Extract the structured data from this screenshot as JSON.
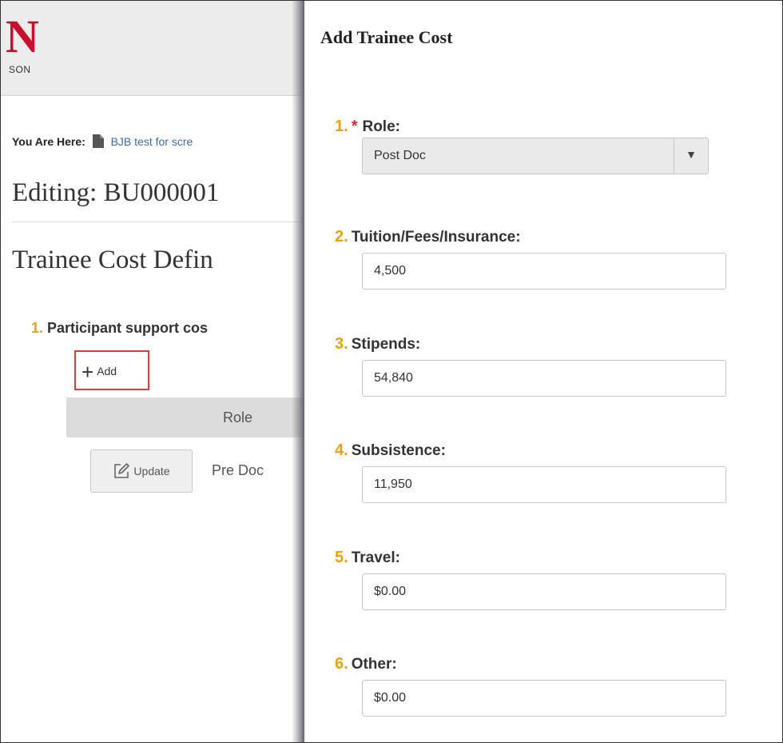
{
  "header": {
    "logo_letter": "N",
    "logo_sub": "SON"
  },
  "breadcrumb": {
    "label": "You Are Here:",
    "link": "BJB test for scre"
  },
  "page": {
    "title": "Editing: BU000001",
    "section_title": "Trainee Cost Defin"
  },
  "participant": {
    "number": "1.",
    "label": "Participant support cos",
    "add_label": "Add",
    "grid_header_role": "Role",
    "rows": [
      {
        "update_label": "Update",
        "role": "Pre Doc"
      }
    ]
  },
  "panel": {
    "title": "Add Trainee Cost",
    "fields": [
      {
        "number": "1.",
        "required": "*",
        "label": "Role:",
        "value": "Post Doc"
      },
      {
        "number": "2.",
        "label": "Tuition/Fees/Insurance:",
        "value": "4,500"
      },
      {
        "number": "3.",
        "label": "Stipends:",
        "value": "54,840"
      },
      {
        "number": "4.",
        "label": "Subsistence:",
        "value": "11,950"
      },
      {
        "number": "5.",
        "label": "Travel:",
        "value": "$0.00"
      },
      {
        "number": "6.",
        "label": "Other:",
        "value": "$0.00"
      }
    ]
  },
  "colors": {
    "accent_number": "#e8a317",
    "required": "#d32f2f",
    "link": "#3a6ea5",
    "logo": "#c8102e",
    "highlight_border": "#e53935"
  },
  "icons": {
    "document": "document-icon",
    "plus": "plus-icon",
    "edit": "edit-icon",
    "dropdown": "caret-down-icon"
  }
}
